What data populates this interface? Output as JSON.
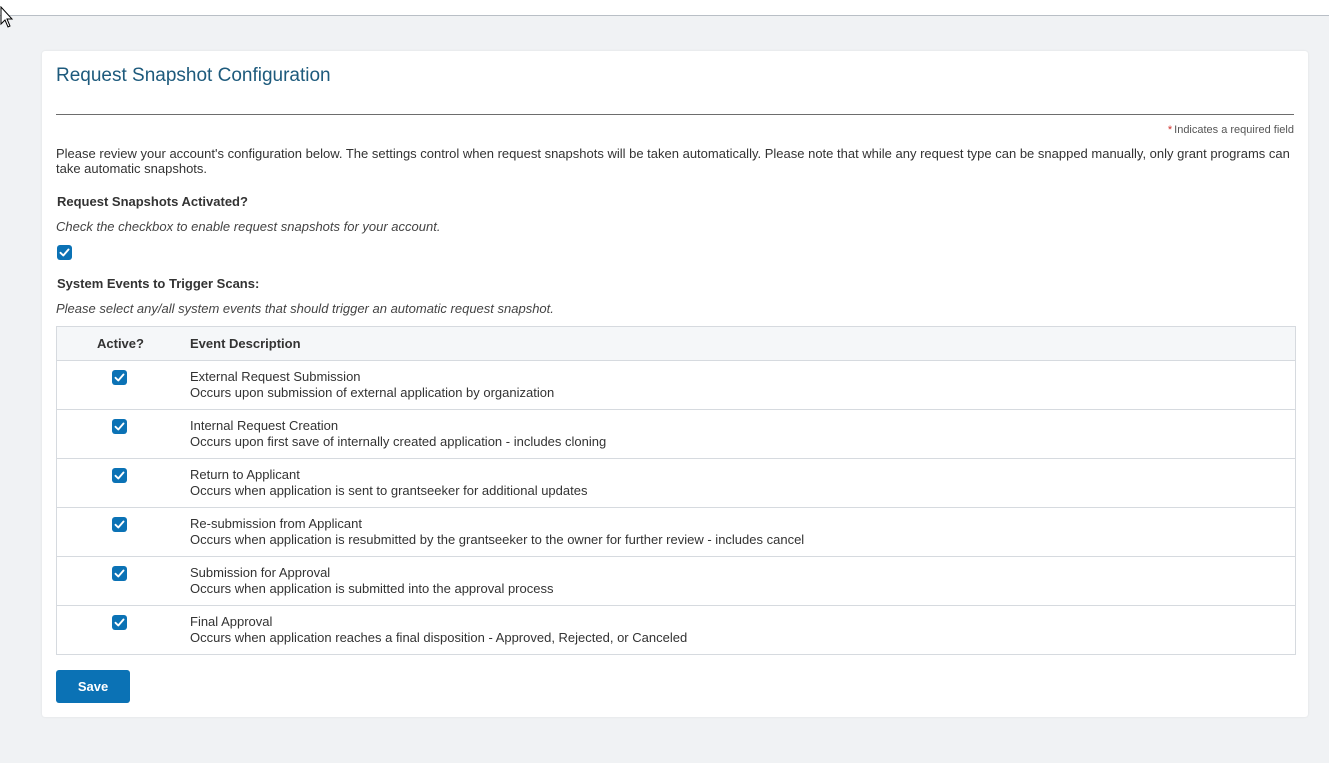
{
  "page": {
    "title": "Request Snapshot Configuration",
    "required_note": "Indicates a required field",
    "intro": "Please review your account's configuration below. The settings control when request snapshots will be taken automatically. Please note that while any request type can be snapped manually, only grant programs can take automatic snapshots."
  },
  "activation": {
    "label": "Request Snapshots Activated?",
    "hint": "Check the checkbox to enable request snapshots for your account.",
    "checked": true
  },
  "events": {
    "label": "System Events to Trigger Scans:",
    "hint": "Please select any/all system events that should trigger an automatic request snapshot.",
    "columns": {
      "active": "Active?",
      "description": "Event Description"
    },
    "rows": [
      {
        "name": "External Request Submission",
        "description": "Occurs upon submission of external application by organization",
        "active": true
      },
      {
        "name": "Internal Request Creation",
        "description": "Occurs upon first save of internally created application - includes cloning",
        "active": true
      },
      {
        "name": "Return to Applicant",
        "description": "Occurs when application is sent to grantseeker for additional updates",
        "active": true
      },
      {
        "name": "Re-submission from Applicant",
        "description": "Occurs when application is resubmitted by the grantseeker to the owner for further review - includes cancel",
        "active": true
      },
      {
        "name": "Submission for Approval",
        "description": "Occurs when application is submitted into the approval process",
        "active": true
      },
      {
        "name": "Final Approval",
        "description": "Occurs when application reaches a final disposition - Approved, Rejected, or Canceled",
        "active": true
      }
    ]
  },
  "actions": {
    "save_label": "Save"
  },
  "colors": {
    "accent": "#0b72b5",
    "title": "#1d5a7c",
    "required_star": "#d0312d",
    "background": "#f0f2f4"
  },
  "icons": {
    "checkbox": "check-icon",
    "pointer": "cursor-arrow-icon"
  }
}
